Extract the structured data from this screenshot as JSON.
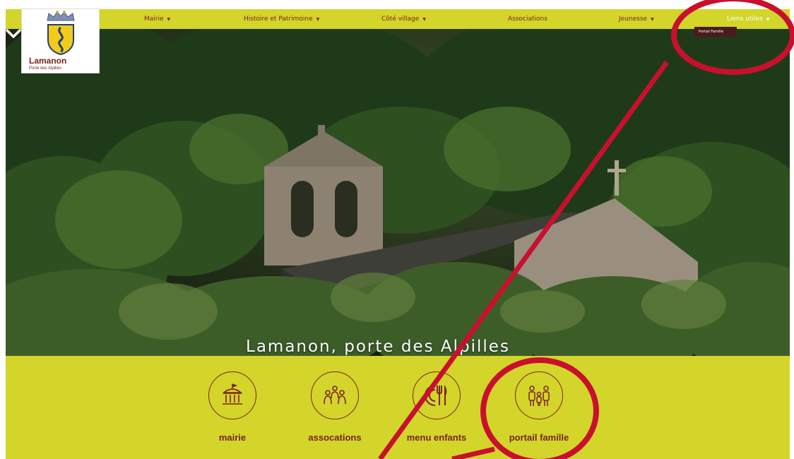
{
  "nav": {
    "items": [
      {
        "label": "Mairie",
        "caret": "▼"
      },
      {
        "label": "Histoire et Patrimoine",
        "caret": "▼"
      },
      {
        "label": "Côté village",
        "caret": "▼"
      },
      {
        "label": "Associations",
        "caret": ""
      },
      {
        "label": "Jeunesse",
        "caret": "▼"
      },
      {
        "label": "Liens utiles",
        "caret": "▼"
      }
    ],
    "dropdown_item": "Portail Famille"
  },
  "logo": {
    "name": "Lamanon",
    "subtitle": "Porte des Alpilles"
  },
  "hero": {
    "title": "Lamanon, porte des Alpilles"
  },
  "quicklinks": [
    {
      "label": "mairie",
      "icon": "town-hall-icon"
    },
    {
      "label": "assocations",
      "icon": "people-group-icon"
    },
    {
      "label": "menu enfants",
      "icon": "plate-cutlery-icon"
    },
    {
      "label": "portail famille",
      "icon": "family-icon"
    }
  ],
  "colors": {
    "accent": "#d3d52a",
    "brand": "#7a2320",
    "annotation": "#c8102e"
  }
}
